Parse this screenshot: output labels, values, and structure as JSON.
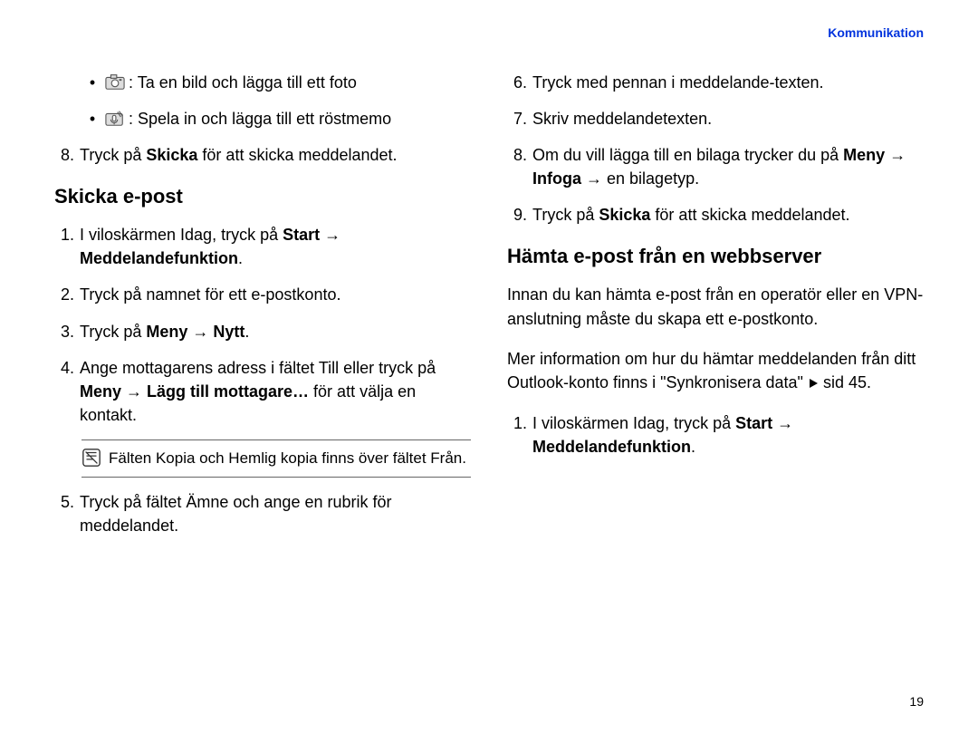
{
  "header": {
    "link": "Kommunikation"
  },
  "page_number": "19",
  "left": {
    "bullets": [
      {
        "icon": "camera",
        "pre": ": ",
        "text": "Ta en bild och lägga till ett foto"
      },
      {
        "icon": "mic",
        "pre": ": ",
        "text": "Spela in och lägga till ett röstmemo"
      }
    ],
    "step8": {
      "num": "8.",
      "pre": "Tryck på ",
      "bold": "Skicka",
      "post": " för att skicka meddelandet."
    },
    "heading1": "Skicka e-post",
    "s1": {
      "num": "1.",
      "pre": "I viloskärmen Idag, tryck på ",
      "b1": "Start",
      "arrow": " → ",
      "b2": "Meddelandefunktion",
      "post": "."
    },
    "s2": {
      "num": "2.",
      "text": "Tryck på namnet för ett e-postkonto."
    },
    "s3": {
      "num": "3.",
      "pre": "Tryck på ",
      "b1": "Meny",
      "arrow": " → ",
      "b2": "Nytt",
      "post": "."
    },
    "s4": {
      "num": "4.",
      "pre": "Ange mottagarens adress i fältet Till eller tryck på ",
      "b1": "Meny",
      "arrow": " → ",
      "b2": "Lägg till mottagare…",
      "post": " för att välja en kontakt."
    },
    "note": "Fälten Kopia och Hemlig kopia finns över fältet Från.",
    "s5": {
      "num": "5.",
      "text": "Tryck på fältet Ämne och ange en rubrik för meddelandet."
    }
  },
  "right": {
    "s6": {
      "num": "6.",
      "text": "Tryck med pennan i meddelande-texten."
    },
    "s7": {
      "num": "7.",
      "text": "Skriv meddelandetexten."
    },
    "s8": {
      "num": "8.",
      "pre": "Om du vill lägga till en bilaga trycker du på ",
      "b1": "Meny",
      "arrow1": " → ",
      "b2": "Infoga",
      "arrow2": " → ",
      "post": "en bilagetyp."
    },
    "s9": {
      "num": "9.",
      "pre": "Tryck på ",
      "b1": "Skicka",
      "post": " för att skicka meddelandet."
    },
    "heading2": "Hämta e-post från en webbserver",
    "para1": "Innan du kan hämta e-post från en operatör eller en VPN-anslutning måste du skapa ett e-postkonto.",
    "para2a": "Mer information om hur du hämtar meddelanden från ditt Outlook-konto finns i \"Synkronisera data\" ",
    "para2b": " sid 45.",
    "r1": {
      "num": "1.",
      "pre": "I viloskärmen Idag, tryck på ",
      "b1": "Start",
      "arrow": " → ",
      "b2": "Meddelandefunktion",
      "post": "."
    }
  }
}
